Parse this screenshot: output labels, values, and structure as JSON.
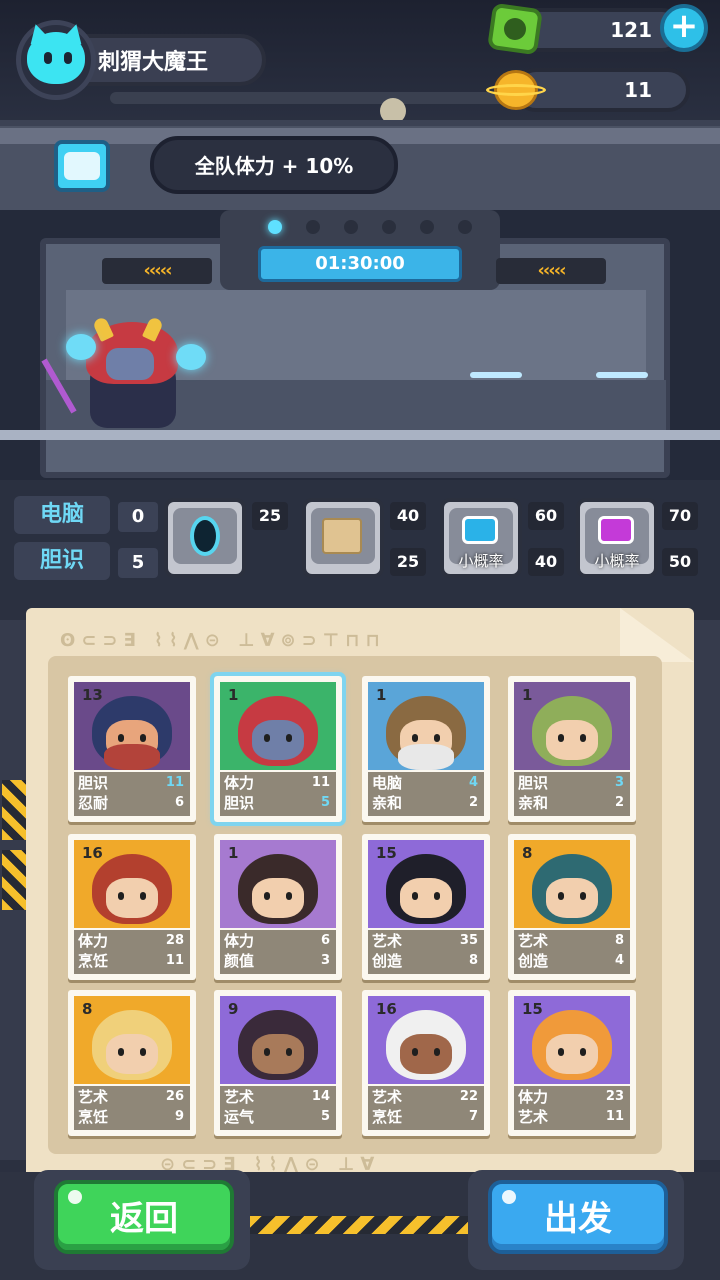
{
  "player": {
    "name": "刺猬大魔王",
    "avatar": "cat-avatar-icon"
  },
  "resources": {
    "gems": "121",
    "coins": "11",
    "gem_icon": "green-gem-icon",
    "coin_icon": "planet-coin-icon",
    "add_label": "+"
  },
  "buff": {
    "text": "全队体力 + 10%",
    "icon": "vehicle-icon"
  },
  "timer": {
    "value": "01:30:00"
  },
  "corridor": {
    "arrows_left": "‹‹‹‹‹",
    "arrows_right": "‹‹‹‹‹"
  },
  "team_stats": [
    {
      "label": "电脑",
      "value": "0"
    },
    {
      "label": "胆识",
      "value": "5"
    }
  ],
  "equipment": [
    {
      "icon": "portal-orb-icon",
      "top": "25",
      "bottom": "",
      "caption": ""
    },
    {
      "icon": "treasure-map-icon",
      "top": "40",
      "bottom": "25",
      "caption": ""
    },
    {
      "icon": "blue-monitor-icon",
      "top": "60",
      "bottom": "40",
      "caption": "小概率"
    },
    {
      "icon": "purple-monitor-icon",
      "top": "70",
      "bottom": "50",
      "caption": "小概率"
    }
  ],
  "panel": {
    "glyphs_top": "ʘ⊂⊃∃ ⌇⌇⋀⊝ ⊥∀⊚⊃⊤⊓⊓",
    "glyphs_bottom": "⊝⊂⊃∃ ⌇⌇⋀⊝ ⊥∀"
  },
  "heroes": [
    {
      "level": "13",
      "stat1": "胆识",
      "val1": "11",
      "hi1": true,
      "stat2": "忍耐",
      "val2": "6",
      "hi2": false,
      "selected": false,
      "bg": "#6a4a8a",
      "hair": "#2d3a6a",
      "skin": "#e8a57c",
      "beard": "#b3433a"
    },
    {
      "level": "1",
      "stat1": "体力",
      "val1": "11",
      "hi1": false,
      "stat2": "胆识",
      "val2": "5",
      "hi2": true,
      "selected": true,
      "bg": "#3bb46a",
      "hair": "#c63a42",
      "skin": "#6f7fa8",
      "beard": ""
    },
    {
      "level": "1",
      "stat1": "电脑",
      "val1": "4",
      "hi1": true,
      "stat2": "亲和",
      "val2": "2",
      "hi2": false,
      "selected": false,
      "bg": "#5aa5d8",
      "hair": "#8a6a42",
      "skin": "#f2cfae",
      "beard": "#e8e8e8"
    },
    {
      "level": "1",
      "stat1": "胆识",
      "val1": "3",
      "hi1": true,
      "stat2": "亲和",
      "val2": "2",
      "hi2": false,
      "selected": false,
      "bg": "#7a5a9a",
      "hair": "#8fae5a",
      "skin": "#f2cfae",
      "beard": ""
    },
    {
      "level": "16",
      "stat1": "体力",
      "val1": "28",
      "hi1": false,
      "stat2": "烹饪",
      "val2": "11",
      "hi2": false,
      "selected": false,
      "bg": "#f0a92a",
      "hair": "#b3402e",
      "skin": "#f2cfae",
      "beard": ""
    },
    {
      "level": "1",
      "stat1": "体力",
      "val1": "6",
      "hi1": false,
      "stat2": "颜值",
      "val2": "3",
      "hi2": false,
      "selected": false,
      "bg": "#a67ad0",
      "hair": "#3a2a2a",
      "skin": "#f2cfae",
      "beard": ""
    },
    {
      "level": "15",
      "stat1": "艺术",
      "val1": "35",
      "hi1": false,
      "stat2": "创造",
      "val2": "8",
      "hi2": false,
      "selected": false,
      "bg": "#8e6ad8",
      "hair": "#1f1f2a",
      "skin": "#f2cfae",
      "beard": ""
    },
    {
      "level": "8",
      "stat1": "艺术",
      "val1": "8",
      "hi1": false,
      "stat2": "创造",
      "val2": "4",
      "hi2": false,
      "selected": false,
      "bg": "#f0a92a",
      "hair": "#2e6a72",
      "skin": "#f2cfae",
      "beard": ""
    },
    {
      "level": "8",
      "stat1": "艺术",
      "val1": "26",
      "hi1": false,
      "stat2": "烹饪",
      "val2": "9",
      "hi2": false,
      "selected": false,
      "bg": "#f0a92a",
      "hair": "#f0d07a",
      "skin": "#f2cfae",
      "beard": ""
    },
    {
      "level": "9",
      "stat1": "艺术",
      "val1": "14",
      "hi1": false,
      "stat2": "运气",
      "val2": "5",
      "hi2": false,
      "selected": false,
      "bg": "#8e6ad8",
      "hair": "#3a2a3a",
      "skin": "#a87a5a",
      "beard": ""
    },
    {
      "level": "16",
      "stat1": "艺术",
      "val1": "22",
      "hi1": false,
      "stat2": "烹饪",
      "val2": "7",
      "hi2": false,
      "selected": false,
      "bg": "#8e6ad8",
      "hair": "#f0f0f0",
      "skin": "#a0674a",
      "beard": ""
    },
    {
      "level": "15",
      "stat1": "体力",
      "val1": "23",
      "hi1": false,
      "stat2": "艺术",
      "val2": "11",
      "hi2": false,
      "selected": false,
      "bg": "#8e6ad8",
      "hair": "#f09a3a",
      "skin": "#f2cfae",
      "beard": ""
    }
  ],
  "buttons": {
    "back": "返回",
    "go": "出发"
  }
}
